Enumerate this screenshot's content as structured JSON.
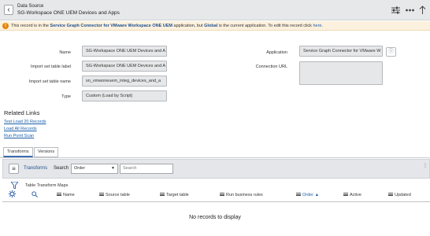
{
  "header": {
    "back_glyph": "‹",
    "kind": "Data Source",
    "title": "SG-Workspace ONE UEM Devices and Apps",
    "icons": [
      "settings-sliders-icon",
      "more-icon",
      "scroll-top-icon"
    ]
  },
  "banner": {
    "pre": "This record is in the ",
    "app": "Service Graph Connector for VMware Workspace ONE UEM",
    "mid": " application, but ",
    "scope": "Global",
    "post": " is the current application. To edit this record click ",
    "link": "here",
    "end": "."
  },
  "form": {
    "name_label": "Name",
    "name_value": "SG-Workspace ONE UEM Devices and A",
    "import_label_label": "Import set table label",
    "import_label_value": "SG-Workspace ONE UEM Devices and A",
    "import_name_label": "Import set table name",
    "import_name_value": "sn_vmwoneuem_integ_devices_and_a",
    "type_label": "Type",
    "type_value": "Custom (Load by Script)",
    "application_label": "Application",
    "application_value": "Service Graph Connector for VMware W",
    "connection_label": "Connection URL",
    "connection_value": ""
  },
  "related_links": {
    "title": "Related Links",
    "links": [
      "Test Load 20 Records",
      "Load All Records",
      "Run Point Scan"
    ]
  },
  "tabs": [
    "Transforms",
    "Versions"
  ],
  "list": {
    "title": "Transforms",
    "search_label": "Search",
    "select_value": "Order",
    "search_placeholder": "Search",
    "filter_label": "Table Transform Maps",
    "columns": [
      "Name",
      "Source table",
      "Target table",
      "Run business rules",
      "Order",
      "Active",
      "Updated"
    ],
    "order_sort": "▲",
    "empty": "No records to display"
  }
}
